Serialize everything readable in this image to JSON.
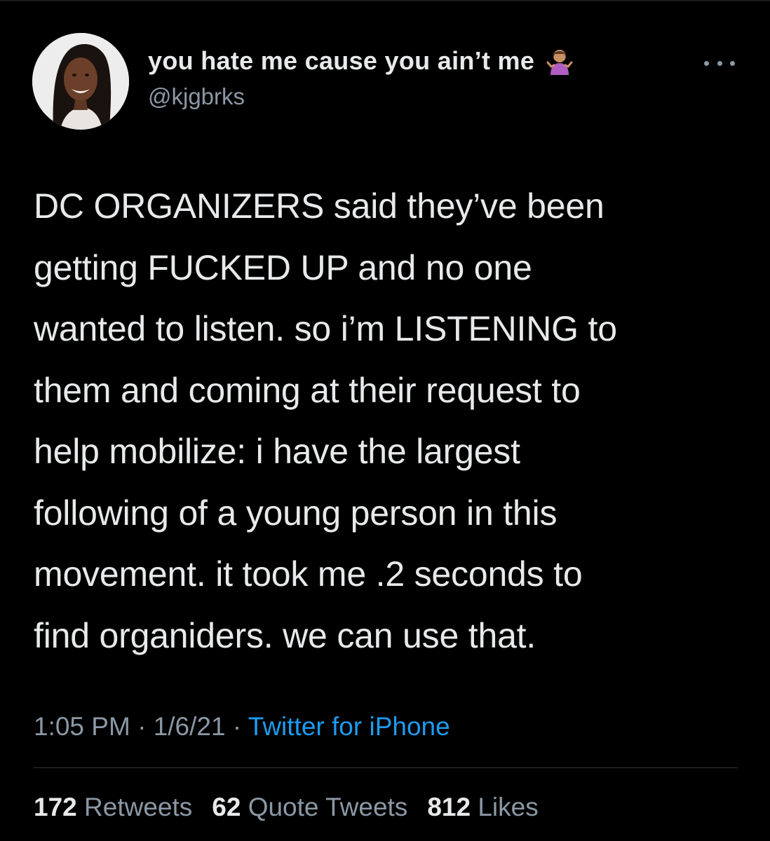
{
  "user": {
    "display_name": "you hate me cause you ain’t me",
    "emoji_icon": "person-shrugging-emoji",
    "handle": "@kjgbrks"
  },
  "tweet": {
    "text": "DC ORGANIZERS said they’ve been\ngetting FUCKED UP and no one\nwanted to listen. so i’m LISTENING to\nthem and coming at their request to\nhelp mobilize: i have the largest\nfollowing of a young person in this\nmovement. it took me .2 seconds to\nfind organiders. we can use that.",
    "time": "1:05 PM",
    "date": "1/6/21",
    "separator": " · ",
    "source": "Twitter for iPhone"
  },
  "stats": {
    "retweets_count": "172",
    "retweets_label": "Retweets",
    "quotes_count": "62",
    "quotes_label": "Quote Tweets",
    "likes_count": "812",
    "likes_label": "Likes"
  },
  "colors": {
    "background": "#000000",
    "text_primary": "#e7e9ea",
    "text_secondary": "#8b98a5",
    "link": "#1d9bf0",
    "divider": "#2f3336"
  }
}
